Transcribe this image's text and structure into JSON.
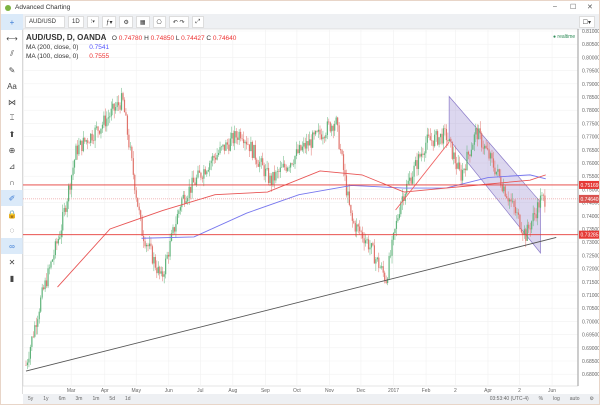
{
  "window": {
    "title": "Advanced Charting",
    "minimize": "–",
    "maximize": "☐",
    "close": "✕"
  },
  "toolbar": {
    "symbol": "AUD/USD",
    "interval": "1D",
    "settings_icon": "gear-icon"
  },
  "legend": {
    "symbol": "AUD/USD, D, OANDA",
    "o_label": "O",
    "o": "0.74780",
    "h_label": "H",
    "h": "0.74850",
    "l_label": "L",
    "l": "0.74427",
    "c_label": "C",
    "c": "0.74640",
    "ma200": {
      "label": "MA (200, close, 0)",
      "value": "0.7541"
    },
    "ma100": {
      "label": "MA (100, close, 0)",
      "value": "0.7555"
    }
  },
  "realtime": "realtime",
  "bottom": {
    "ranges": [
      "5y",
      "1y",
      "6m",
      "3m",
      "1m",
      "5d",
      "1d"
    ],
    "time": "03:53:40 (UTC-4)",
    "pct": "%",
    "log": "log",
    "auto": "auto"
  },
  "chart_data": {
    "type": "candlestick",
    "ylim": [
      0.675,
      0.81
    ],
    "yticks": [
      "0.81000",
      "0.80500",
      "0.80000",
      "0.79500",
      "0.79000",
      "0.78500",
      "0.78000",
      "0.77500",
      "0.77000",
      "0.76500",
      "0.76000",
      "0.75500",
      "0.75000",
      "0.74500",
      "0.74000",
      "0.73500",
      "0.73000",
      "0.72500",
      "0.72000",
      "0.71500",
      "0.71000",
      "0.70500",
      "0.70000",
      "0.69500",
      "0.69000",
      "0.68500",
      "0.68000"
    ],
    "xticks": [
      {
        "label": "Mar",
        "day": 43
      },
      {
        "label": "Apr",
        "day": 75
      },
      {
        "label": "May",
        "day": 105
      },
      {
        "label": "Jun",
        "day": 136
      },
      {
        "label": "Jul",
        "day": 166
      },
      {
        "label": "Aug",
        "day": 197
      },
      {
        "label": "Sep",
        "day": 228
      },
      {
        "label": "Oct",
        "day": 258
      },
      {
        "label": "Nov",
        "day": 289
      },
      {
        "label": "Dec",
        "day": 319
      },
      {
        "label": "2017",
        "day": 350
      },
      {
        "label": "Feb",
        "day": 381
      },
      {
        "label": "2",
        "day": 409
      },
      {
        "label": "Apr",
        "day": 440
      },
      {
        "label": "2",
        "day": 470
      },
      {
        "label": "Jun",
        "day": 501
      }
    ],
    "price_path": [
      [
        0,
        0.6835
      ],
      [
        14,
        0.708
      ],
      [
        33,
        0.7346
      ],
      [
        48,
        0.765
      ],
      [
        71,
        0.774
      ],
      [
        92,
        0.784
      ],
      [
        110,
        0.7346
      ],
      [
        129,
        0.716
      ],
      [
        148,
        0.746
      ],
      [
        176,
        0.761
      ],
      [
        205,
        0.772
      ],
      [
        233,
        0.753
      ],
      [
        262,
        0.765
      ],
      [
        295,
        0.776
      ],
      [
        310,
        0.738
      ],
      [
        324,
        0.731
      ],
      [
        343,
        0.716
      ],
      [
        357,
        0.746
      ],
      [
        381,
        0.768
      ],
      [
        400,
        0.7706
      ],
      [
        414,
        0.755
      ],
      [
        429,
        0.772
      ],
      [
        452,
        0.7536
      ],
      [
        476,
        0.7327
      ],
      [
        490,
        0.746
      ],
      [
        495,
        0.7464
      ]
    ],
    "ma200_path": [
      [
        110,
        0.7315
      ],
      [
        160,
        0.732
      ],
      [
        210,
        0.741
      ],
      [
        260,
        0.748
      ],
      [
        310,
        0.7515
      ],
      [
        360,
        0.7505
      ],
      [
        400,
        0.7505
      ],
      [
        440,
        0.7545
      ],
      [
        480,
        0.7555
      ],
      [
        495,
        0.754
      ]
    ],
    "ma100_path": [
      [
        30,
        0.713
      ],
      [
        80,
        0.735
      ],
      [
        130,
        0.742
      ],
      [
        180,
        0.748
      ],
      [
        230,
        0.749
      ],
      [
        280,
        0.757
      ],
      [
        320,
        0.7555
      ],
      [
        360,
        0.749
      ],
      [
        400,
        0.7505
      ],
      [
        440,
        0.752
      ],
      [
        480,
        0.7535
      ],
      [
        495,
        0.7555
      ]
    ],
    "levels": [
      {
        "price": 0.75169,
        "label": "0.75169"
      },
      {
        "price": 0.73285,
        "label": "0.73285"
      }
    ],
    "last_price": {
      "price": 0.7464,
      "label": "0.74640"
    },
    "trendline": [
      [
        0,
        0.6812
      ],
      [
        505,
        0.7318
      ]
    ],
    "red_line": [
      [
        352,
        0.7422
      ],
      [
        403,
        0.7679
      ]
    ],
    "channel": [
      [
        403,
        0.7852
      ],
      [
        490,
        0.7452
      ],
      [
        490,
        0.7259
      ],
      [
        403,
        0.7689
      ]
    ],
    "colors": {
      "up": "#5fb37a",
      "down": "#e0736b",
      "ma200": "#7777ee",
      "ma100": "#e85555",
      "channel": "#9b8bd0",
      "level": "#e53935"
    }
  }
}
